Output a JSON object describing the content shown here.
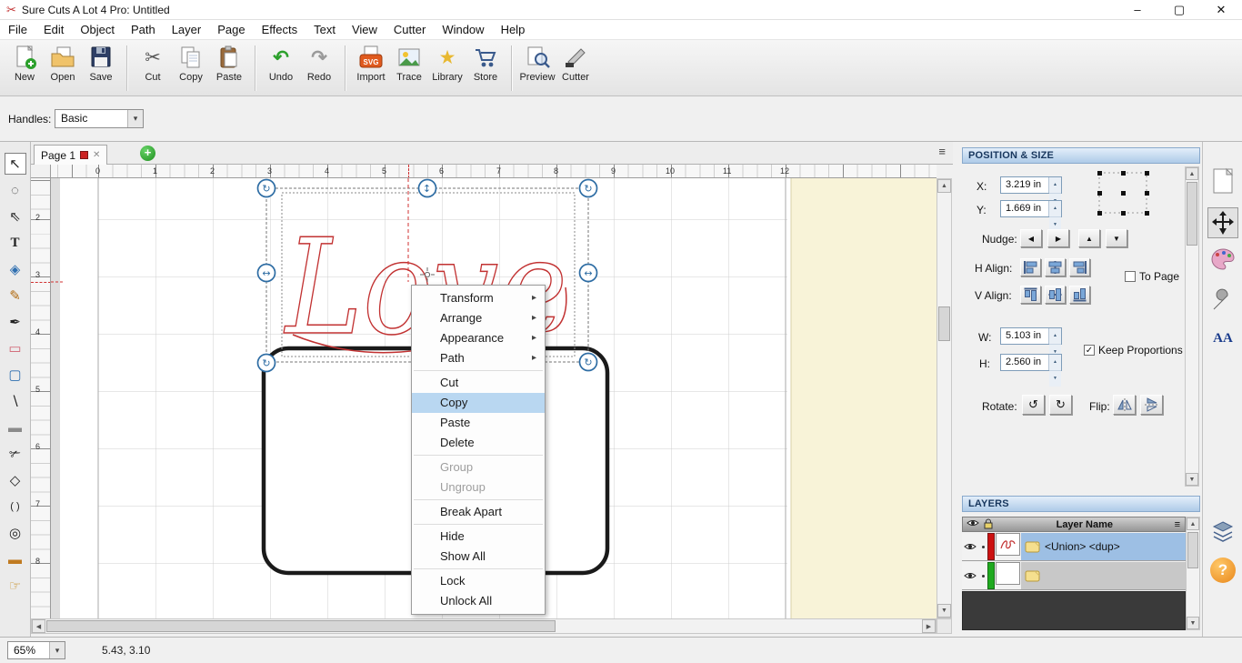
{
  "window": {
    "title": "Sure Cuts A Lot 4 Pro: Untitled"
  },
  "icons": {
    "app_logo": "✂",
    "minimize": "–",
    "maximize": "▢",
    "close": "✕",
    "submenu_arrow": "▸",
    "dropdown_arrow": "▾",
    "tab_close": "✕",
    "tab_add": "+",
    "menu": "≡",
    "scissors": "✂",
    "undo": "↶",
    "redo": "↷",
    "star": "★",
    "left": "◀",
    "right": "▶",
    "up": "▲",
    "down": "▼",
    "rotate_left": "↺",
    "rotate_right": "↻",
    "check": "✓",
    "scroll_up": "▲",
    "scroll_down": "▼",
    "scroll_left": "◀",
    "scroll_right": "▶"
  },
  "menu": {
    "items": [
      "File",
      "Edit",
      "Object",
      "Path",
      "Layer",
      "Page",
      "Effects",
      "Text",
      "View",
      "Cutter",
      "Window",
      "Help"
    ]
  },
  "toolbar": {
    "buttons": [
      "New",
      "Open",
      "Save",
      "Cut",
      "Copy",
      "Paste",
      "Undo",
      "Redo",
      "Import",
      "Trace",
      "Library",
      "Store",
      "Preview",
      "Cutter"
    ],
    "import_badge": "SVG"
  },
  "handles_bar": {
    "label": "Handles:",
    "value": "Basic"
  },
  "page_tab": {
    "label": "Page 1"
  },
  "canvas": {
    "artwork_text": "Love",
    "artwork_color": "#c23232",
    "ruler_h": [
      "0",
      "1",
      "2",
      "3",
      "4",
      "5",
      "6",
      "7",
      "8",
      "9",
      "10",
      "11",
      "12"
    ],
    "ruler_v": [
      "2",
      "3",
      "4",
      "5",
      "6",
      "7",
      "8"
    ]
  },
  "context_menu": {
    "items": [
      {
        "label": "Transform"
      },
      {
        "label": "Arrange"
      },
      {
        "label": "Appearance"
      },
      {
        "label": "Path"
      },
      {
        "label": "Cut"
      },
      {
        "label": "Copy"
      },
      {
        "label": "Paste"
      },
      {
        "label": "Delete"
      },
      {
        "label": "Group"
      },
      {
        "label": "Ungroup"
      },
      {
        "label": "Break Apart"
      },
      {
        "label": "Hide"
      },
      {
        "label": "Show All"
      },
      {
        "label": "Lock"
      },
      {
        "label": "Unlock All"
      }
    ],
    "highlighted": "Copy",
    "highlight_color": "#b9d7f1"
  },
  "position_size": {
    "title": "POSITION & SIZE",
    "x_label": "X:",
    "x_value": "3.219 in",
    "y_label": "Y:",
    "y_value": "1.669 in",
    "nudge_label": "Nudge:",
    "h_align_label": "H Align:",
    "v_align_label": "V Align:",
    "to_page_label": "To Page",
    "w_label": "W:",
    "w_value": "5.103 in",
    "h_label": "H:",
    "h_value": "2.560 in",
    "keep_proportions_label": "Keep Proportions",
    "rotate_label": "Rotate:",
    "flip_label": "Flip:"
  },
  "layers": {
    "title": "LAYERS",
    "name_header": "Layer Name",
    "rows": [
      {
        "name": "<Union> <dup>",
        "color": "#cc1111",
        "selected": true
      },
      {
        "name": "",
        "color": "#1faa1f",
        "selected": false
      }
    ]
  },
  "right_tools": {
    "fonts_label": "AA",
    "help_label": "?"
  },
  "left_tools": [
    {
      "name": "selection-tool",
      "glyph": "↖"
    },
    {
      "name": "lasso-select-tool",
      "glyph": "◌"
    },
    {
      "name": "direct-select-tool",
      "glyph": "⇖"
    },
    {
      "name": "text-tool",
      "glyph": "T"
    },
    {
      "name": "fill-tool",
      "glyph": "◈",
      "style": "color:#2f6fb0"
    },
    {
      "name": "pencil-tool",
      "glyph": "✎",
      "style": "color:#b06a10"
    },
    {
      "name": "pen-tool",
      "glyph": "✒"
    },
    {
      "name": "eraser-tool",
      "glyph": "▭",
      "style": "color:#d06070"
    },
    {
      "name": "shape-tool",
      "glyph": "▢",
      "style": "color:#2f6fb0"
    },
    {
      "name": "eyedropper-tool",
      "glyph": "∖"
    },
    {
      "name": "shadow-tool",
      "glyph": "▬",
      "style": "color:#8a8a8a"
    },
    {
      "name": "knife-tool",
      "glyph": "✃"
    },
    {
      "name": "polygon-tool",
      "glyph": "◇"
    },
    {
      "name": "node-edit-tool",
      "glyph": "( )"
    },
    {
      "name": "zoom-tool",
      "glyph": "◎"
    },
    {
      "name": "ruler-tool",
      "glyph": "▬",
      "style": "color:#c07a20"
    },
    {
      "name": "pan-tool",
      "glyph": "☞",
      "style": "color:#c8922a"
    }
  ],
  "status_bar": {
    "zoom": "65%",
    "coordinates": "5.43, 3.10"
  }
}
